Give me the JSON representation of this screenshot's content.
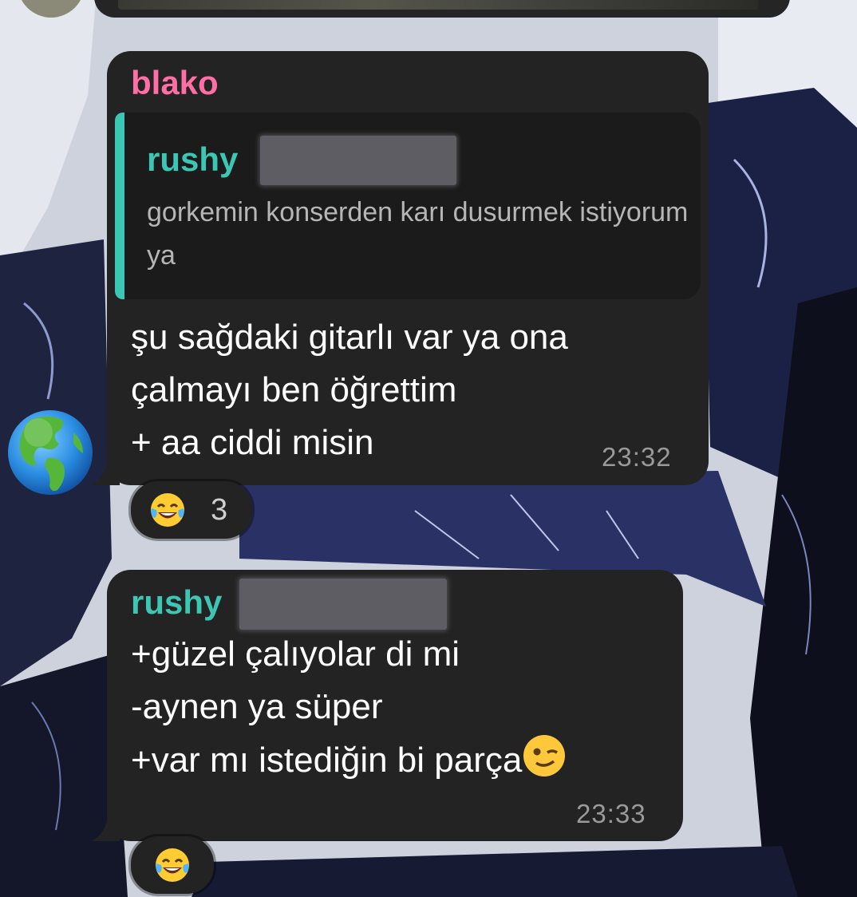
{
  "messages": [
    {
      "sender": "blako",
      "reply": {
        "name": "rushy",
        "text": "gorkemin konserden karı dusurmek istiyorum ya"
      },
      "lines": [
        "şu sağdaki gitarlı var ya ona",
        "çalmayı ben öğrettim",
        "+ aa ciddi misin"
      ],
      "time": "23:32",
      "reaction": {
        "emoji": "tears-of-joy-emoji",
        "count": "3"
      }
    },
    {
      "sender": "rushy",
      "lines": [
        "+güzel çalıyolar di mi",
        "-aynen ya süper",
        "+var mı istediğin bi parça"
      ],
      "inline_emoji": "winking-face-emoji",
      "time": "23:33",
      "reaction": {
        "emoji": "tears-of-joy-emoji"
      }
    }
  ],
  "avatar": {
    "icon": "globe-americas-emoji"
  },
  "colors": {
    "bubble": "#232323",
    "blako_name": "#ff6fa6",
    "rushy_name": "#3cc7b4",
    "timestamp": "#9a9a9a"
  }
}
